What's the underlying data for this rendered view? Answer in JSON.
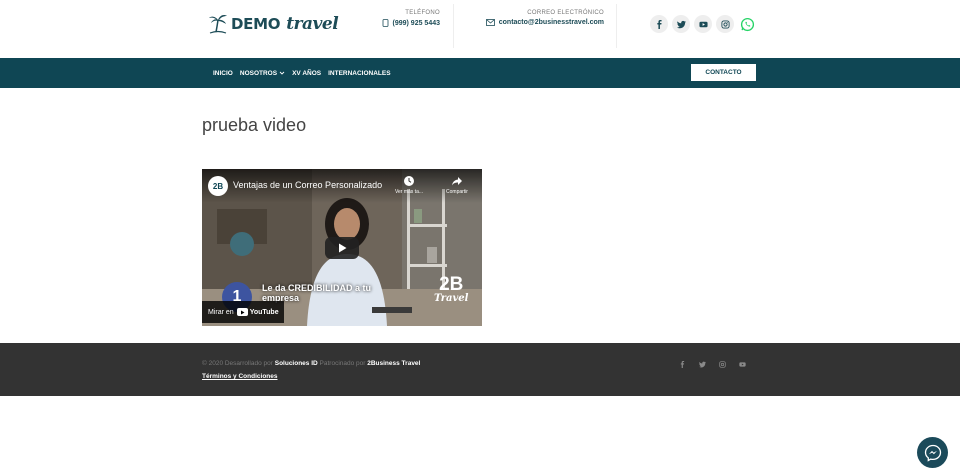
{
  "brand": {
    "logo_demo": "DEMO",
    "logo_travel": "travel"
  },
  "header": {
    "phone_label": "TELÉFONO",
    "phone_value": "(999) 925 5443",
    "email_label": "CORREO ELECTRÓNICO",
    "email_value": "contacto@2businesstravel.com",
    "social_icons": [
      "facebook-icon",
      "twitter-icon",
      "youtube-icon",
      "instagram-icon",
      "whatsapp-icon"
    ]
  },
  "nav": {
    "items": [
      {
        "label": "INICIO"
      },
      {
        "label": "NOSOTROS"
      },
      {
        "label": "XV AÑOS"
      },
      {
        "label": "INTERNACIONALES"
      }
    ],
    "contact_button": "CONTACTO"
  },
  "main": {
    "title": "prueba video",
    "video": {
      "channel_avatar": "2B",
      "title": "Ventajas de un Correo Personalizado",
      "watch_later": "Ver más ta...",
      "share": "Compartir",
      "badge_number": "1",
      "overlay_text": "Le da CREDIBILIDAD a tu empresa",
      "brand_big": "2B",
      "brand_small": "Travel",
      "watch_on": "Mirar en",
      "youtube": "YouTube"
    }
  },
  "footer": {
    "copyright_prefix": "© 2020 Desarrollado por",
    "developer": "Soluciones ID",
    "sponsored_prefix": "Patrocinado por",
    "sponsor": "2Business Travel",
    "terms": "Términos y Condiciones"
  },
  "colors": {
    "nav_bg": "#0f4654",
    "brand_text": "#1d4c57",
    "footer_bg": "#333333",
    "whatsapp": "#25d366"
  }
}
